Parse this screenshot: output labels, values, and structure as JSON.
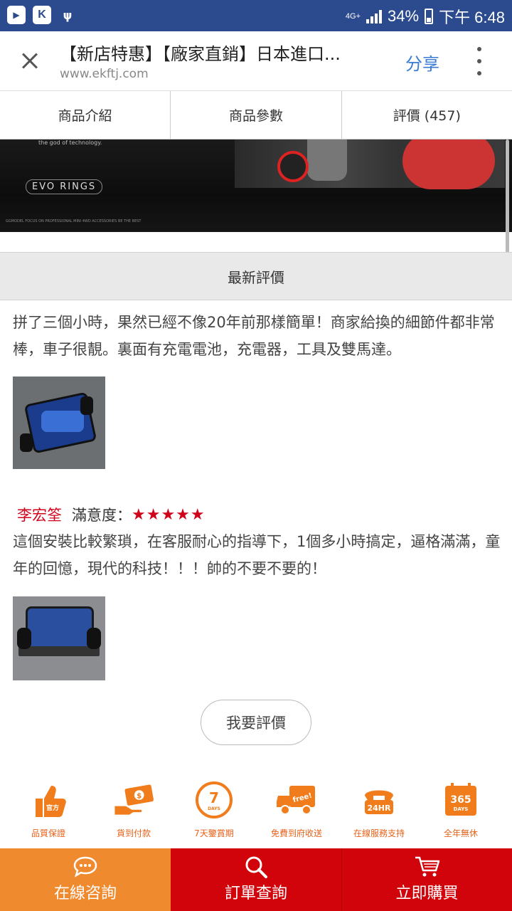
{
  "status_bar": {
    "network": "4G+",
    "battery": "34%",
    "time": "下午 6:48",
    "icons": [
      "youtube-icon",
      "k-app-icon",
      "usb-icon",
      "signal-icon",
      "battery-icon"
    ]
  },
  "header": {
    "title": "【新店特惠】【廠家直銷】日本進口...",
    "url": "www.ekftj.com",
    "share_label": "分享"
  },
  "tabs": [
    {
      "label": "商品介紹"
    },
    {
      "label": "商品參數"
    },
    {
      "label": "評價 (457)"
    }
  ],
  "banner": {
    "tagline": "the god of technology.",
    "badge": "EVO RINGS",
    "footer": "GGMODEL FOCUS ON PROFESSIONAL MINI 4WD ACCESSORIES BE THE BEST"
  },
  "section_title": "最新評價",
  "reviews": [
    {
      "text": "拼了三個小時，果然已經不像20年前那樣簡單！商家給換的細節件都非常棒，車子很靚。裏面有充電電池，充電器，工具及雙馬達。"
    },
    {
      "reviewer": "李宏筌",
      "satisfaction_label": "滿意度：",
      "rating": 5,
      "stars": "★★★★★",
      "text": "這個安裝比較繁瑣，在客服耐心的指導下，1個多小時搞定，逼格滿滿，童年的回憶，現代的科技！！！帥的不要不要的！"
    }
  ],
  "review_button": "我要評價",
  "features": [
    {
      "label": "品質保證",
      "icon_text": "官方\n正品"
    },
    {
      "label": "貨到付款",
      "icon_text": "$"
    },
    {
      "label": "7天鑒賞期",
      "icon_text": "7\nDAYS"
    },
    {
      "label": "免費到府收送",
      "icon_text": "free!"
    },
    {
      "label": "在線服務支持",
      "icon_text": "24HR"
    },
    {
      "label": "全年無休",
      "icon_text": "365\nDAYS"
    }
  ],
  "bottom_bar": {
    "consult": "在線咨詢",
    "order": "訂單查詢",
    "buy": "立即購買"
  },
  "colors": {
    "status_bar": "#2c4a8e",
    "accent_red": "#d0021b",
    "accent_orange": "#f08a2e",
    "share_blue": "#3a7bd5"
  }
}
